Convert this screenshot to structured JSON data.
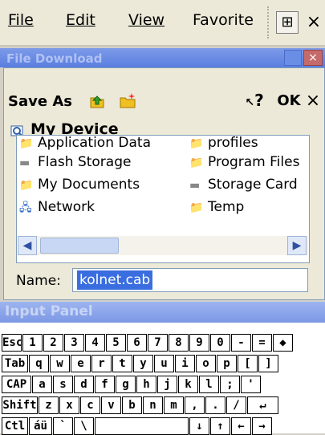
{
  "menubar": {
    "items": [
      {
        "label": "File"
      },
      {
        "label": "Edit"
      },
      {
        "label": "View"
      },
      {
        "label": "Favorite"
      }
    ],
    "tool_icon": "window-icon",
    "close_label": "×"
  },
  "download_window": {
    "title": "File Download",
    "close_label": "×"
  },
  "dialog": {
    "title": "Save As",
    "ok_label": "OK",
    "help_label": "?",
    "close_label": "×",
    "location": "My Device",
    "files_col1": [
      {
        "name": "Application Data",
        "type": "folder"
      },
      {
        "name": "Flash Storage",
        "type": "drive"
      },
      {
        "name": "My Documents",
        "type": "folder"
      },
      {
        "name": "Network",
        "type": "network"
      }
    ],
    "files_col2": [
      {
        "name": "profiles",
        "type": "folder"
      },
      {
        "name": "Program Files",
        "type": "folder"
      },
      {
        "name": "Storage Card",
        "type": "drive"
      },
      {
        "name": "Temp",
        "type": "folder"
      }
    ],
    "name_label": "Name:",
    "name_value": "kolnet.cab"
  },
  "input_panel": {
    "title": "Input Panel",
    "rows": [
      [
        "Esc",
        "1",
        "2",
        "3",
        "4",
        "5",
        "6",
        "7",
        "8",
        "9",
        "0",
        "-",
        "=",
        "◆"
      ],
      [
        "Tab",
        "q",
        "w",
        "e",
        "r",
        "t",
        "y",
        "u",
        "i",
        "o",
        "p",
        "[",
        "]"
      ],
      [
        "CAP",
        "a",
        "s",
        "d",
        "f",
        "g",
        "h",
        "j",
        "k",
        "l",
        ";",
        "'"
      ],
      [
        "Shift",
        "z",
        "x",
        "c",
        "v",
        "b",
        "n",
        "m",
        ",",
        ".",
        "/",
        "↵"
      ],
      [
        "Ctl",
        "áü",
        "`",
        "\\",
        "",
        "↓",
        "↑",
        "←",
        "→"
      ]
    ]
  }
}
